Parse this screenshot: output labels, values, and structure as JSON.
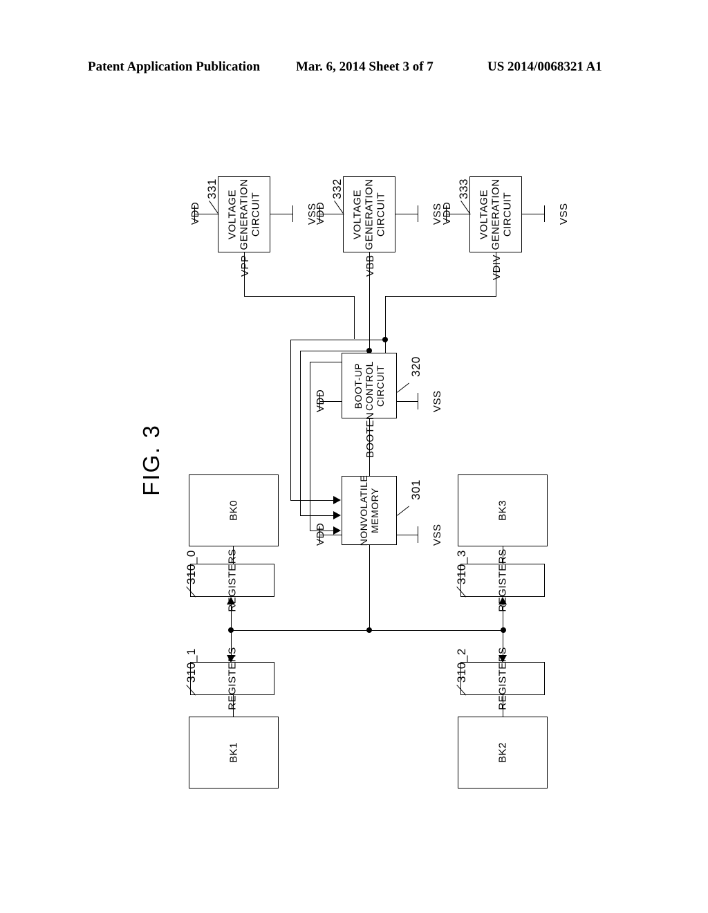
{
  "header": {
    "left": "Patent Application Publication",
    "middle": "Mar. 6, 2014  Sheet 3 of 7",
    "right": "US 2014/0068321 A1"
  },
  "figure": {
    "label": "FIG. 3"
  },
  "voltage_generators": [
    {
      "ref": "331",
      "title": "VOLTAGE GENERATION CIRCUIT",
      "line1": "VOLTAGE",
      "line2": "GENERATION",
      "line3": "CIRCUIT",
      "supply": "VDD",
      "ground": "VSS",
      "output": "VPP"
    },
    {
      "ref": "332",
      "title": "VOLTAGE GENERATION CIRCUIT",
      "line1": "VOLTAGE",
      "line2": "GENERATION",
      "line3": "CIRCUIT",
      "supply": "VDD",
      "ground": "VSS",
      "output": "VBB"
    },
    {
      "ref": "333",
      "title": "VOLTAGE GENERATION CIRCUIT",
      "line1": "VOLTAGE",
      "line2": "GENERATION",
      "line3": "CIRCUIT",
      "supply": "VDD",
      "ground": "VSS",
      "output": "VDIV"
    }
  ],
  "boot_up_control": {
    "ref": "320",
    "line1": "BOOT-UP",
    "line2": "CONTROL",
    "line3": "CIRCUIT",
    "supply": "VDD",
    "ground": "VSS",
    "output": "BOOTEN"
  },
  "nonvolatile_memory": {
    "ref": "301",
    "line1": "NONVOLATILE",
    "line2": "MEMORY",
    "supply": "VDD",
    "ground": "VSS"
  },
  "banks": [
    {
      "name": "BK0",
      "register_label": "REGISTERS",
      "register_ref": "310_0"
    },
    {
      "name": "BK1",
      "register_label": "REGISTERS",
      "register_ref": "310_1"
    },
    {
      "name": "BK2",
      "register_label": "REGISTERS",
      "register_ref": "310_2"
    },
    {
      "name": "BK3",
      "register_label": "REGISTERS",
      "register_ref": "310_3"
    }
  ]
}
